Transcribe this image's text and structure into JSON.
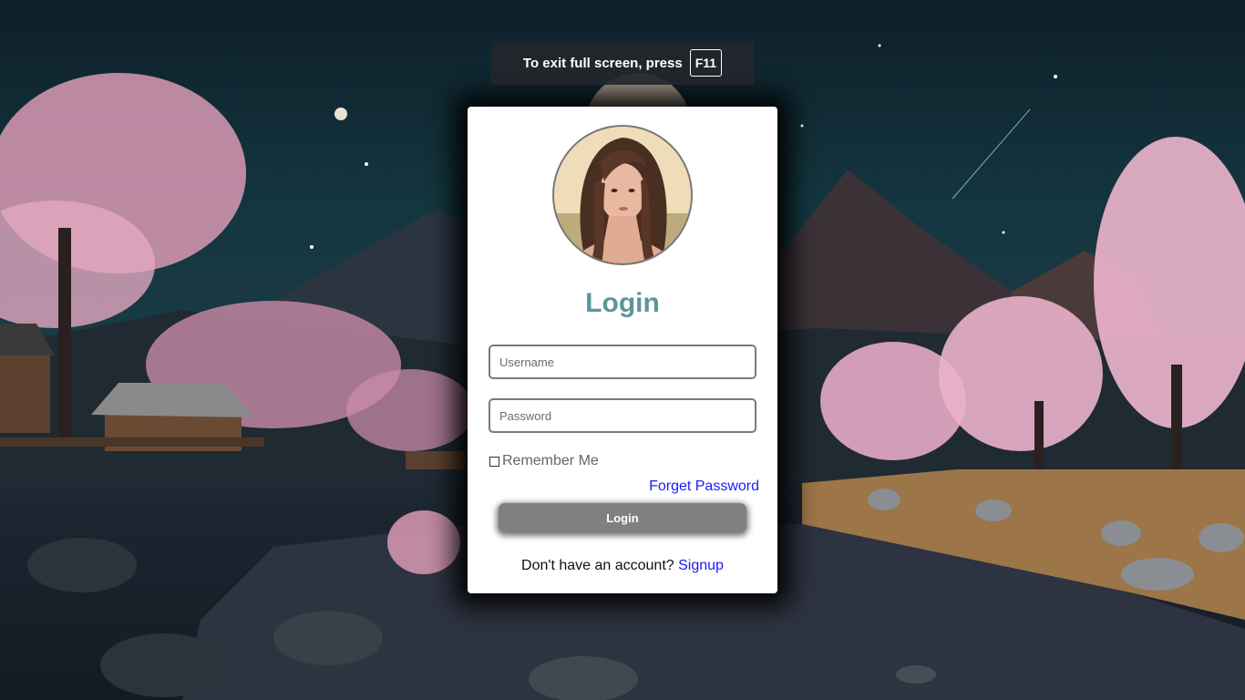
{
  "fullscreen_notice": {
    "message": "To exit full screen, press",
    "key": "F11"
  },
  "login_card": {
    "title": "Login",
    "username_placeholder": "Username",
    "password_placeholder": "Password",
    "remember_label": "Remember Me",
    "forget_link": "Forget Password",
    "login_button": "Login",
    "signup_prompt": "Don't have an account?",
    "signup_link": "Signup"
  },
  "colors": {
    "title": "#5b959b",
    "link": "#1a1aff",
    "button": "#808080"
  }
}
